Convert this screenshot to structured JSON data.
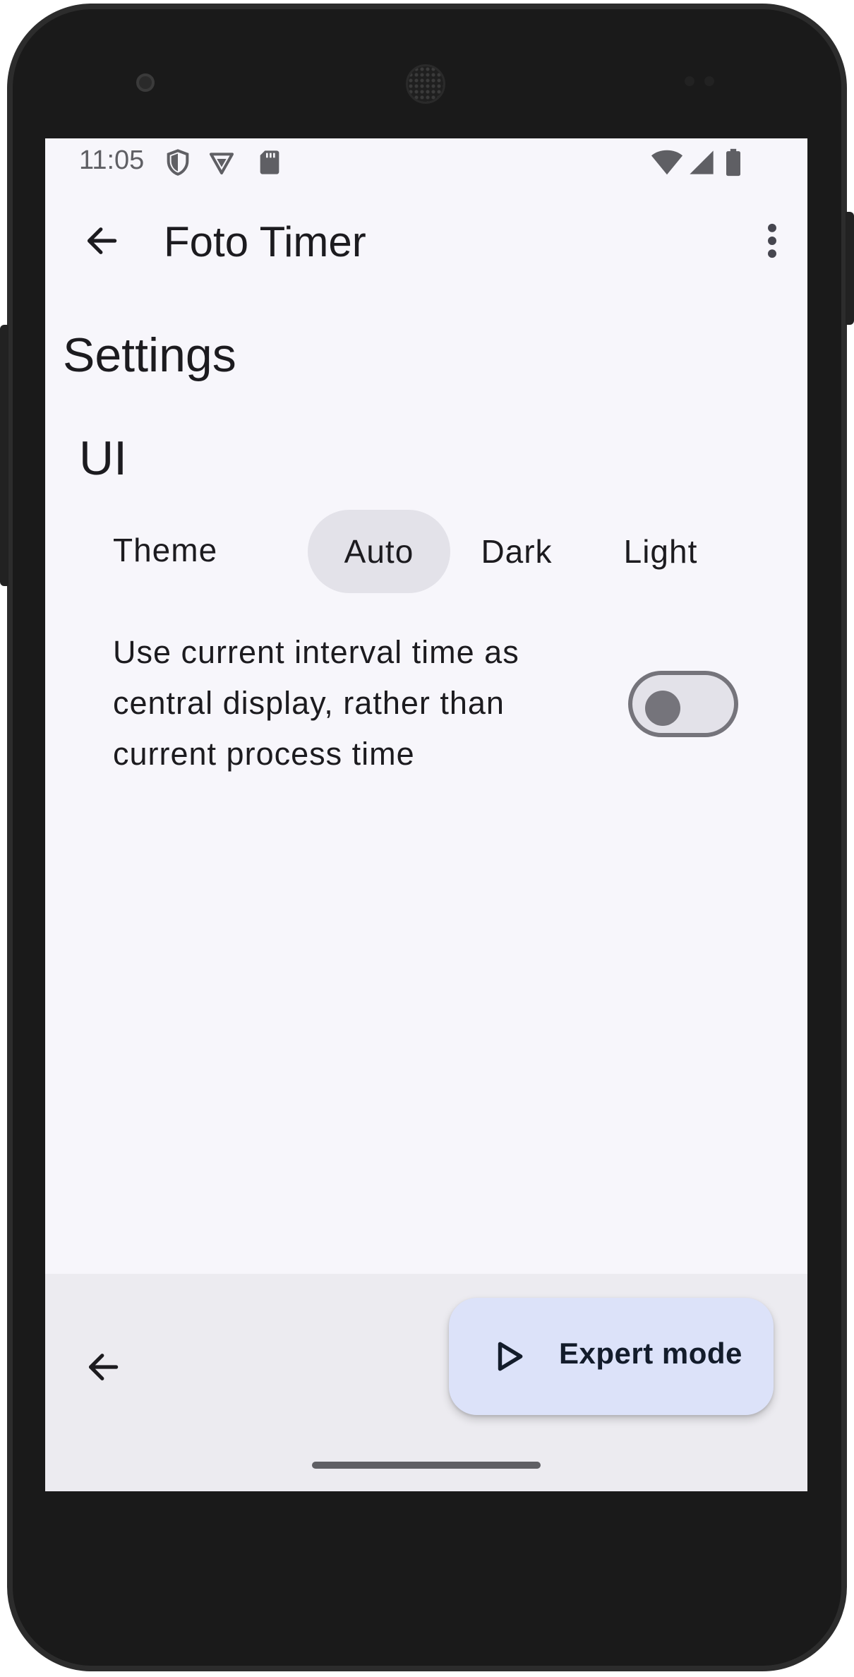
{
  "status_bar": {
    "time": "11:05",
    "icons": [
      "shield-icon",
      "vpn-icon",
      "sd-card-icon",
      "wifi-icon",
      "signal-icon",
      "battery-icon"
    ]
  },
  "app_bar": {
    "title": "Foto Timer",
    "back_icon": "arrow-back-icon",
    "menu_icon": "more-vert-icon"
  },
  "page": {
    "heading": "Settings"
  },
  "sections": {
    "ui": {
      "title": "UI",
      "theme": {
        "label": "Theme",
        "options": [
          "Auto",
          "Dark",
          "Light"
        ],
        "selected": "Auto"
      },
      "interval_pref": {
        "text": "Use current interval time as central display, rather than current process time",
        "enabled": false
      }
    }
  },
  "bottom_bar": {
    "back_icon": "arrow-back-icon",
    "fab": {
      "label": "Expert mode",
      "icon": "play-outline-icon"
    }
  },
  "colors": {
    "background": "#f7f6fb",
    "selected_segment": "#e3e2e9",
    "fab_background": "#dce2f9",
    "bottom_bar": "#ecebf0"
  }
}
